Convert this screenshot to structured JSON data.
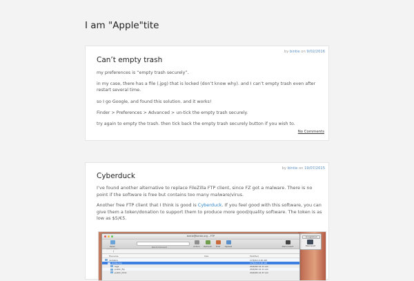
{
  "site": {
    "title": "I am \"Apple\"tite"
  },
  "posts": [
    {
      "meta": {
        "prefix": "by ",
        "author": "bintie",
        "on": " on ",
        "date": "9/02/2016"
      },
      "title": "Can’t empty trash",
      "paragraphs": [
        "my preferences is “empty trash securely”.",
        "in my case, there has a file (.jpg) that is locked (don’t know why). and I can’t empty trash even after restart several time.",
        "so I go Google, and found this solution. and it works!",
        "Finder > Preferences > Advanced > un-tick the empty trash securely.",
        "try again to empty the trash. then tick back the empty trash securely button if you wish to."
      ],
      "comments_link": "No Comments"
    },
    {
      "meta": {
        "prefix": "by ",
        "author": "bintie",
        "on": " on ",
        "date": "19/07/2015"
      },
      "title": "Cyberduck",
      "paragraph_1": "I’ve found another alternative to replace FileZilla FTP client, since FZ got a malware. There is no point if the software is free but contains too many malware/virus.",
      "paragraph_2_before": "Another free FTP client that I think is good is ",
      "paragraph_2_link": "Cyberduck",
      "paragraph_2_after": ". If you feel good with this software, you can give them a token/donation to support them to produce more good/quality software. The token is as low as $5/€5.",
      "screenshot": {
        "window_title": "bintie@bintie.org – FTP",
        "toolbar": [
          "Open Connection",
          "Quick Connect",
          "Action",
          "Refresh",
          "Edit",
          "Upload",
          "Disconnect"
        ],
        "path": "/",
        "columns": {
          "name": "Filename",
          "size": "Size",
          "modified": "Modified"
        },
        "side_button": "Unregistered",
        "side_label": "Disconnect",
        "rows": [
          {
            "name": "domains",
            "modified": "17/6/14 2:20 AM",
            "indent": 0
          },
          {
            "name": "bintie.org",
            "modified": "17/6/14 2:20 AM",
            "indent": 1
          },
          {
            "name": "logs",
            "modified": "29/6/09 12:11 am",
            "indent": 2
          },
          {
            "name": "public_ftp",
            "modified": "29/6/09 12:11 am",
            "indent": 2
          },
          {
            "name": "public_html",
            "modified": "29/6/09 12:47 am",
            "indent": 2
          }
        ]
      }
    }
  ]
}
